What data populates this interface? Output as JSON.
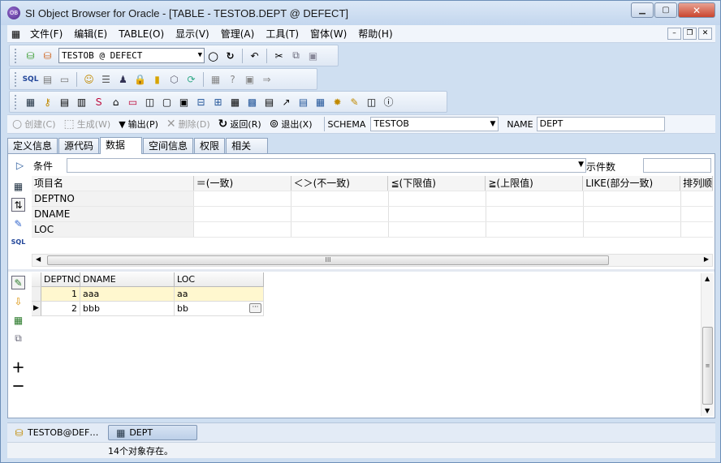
{
  "window": {
    "title": "SI Object Browser for Oracle - [TABLE - TESTOB.DEPT @ DEFECT]",
    "app_icon": "OB"
  },
  "menu": [
    "文件(F)",
    "编辑(E)",
    "TABLE(O)",
    "显示(V)",
    "管理(A)",
    "工具(T)",
    "窗体(W)",
    "帮助(H)"
  ],
  "toolbar": {
    "connection": "TESTOB @ DEFECT"
  },
  "actions": {
    "create": "创建(C)",
    "generate": "生成(W)",
    "output": "输出(P)",
    "delete": "删除(D)",
    "back": "返回(R)",
    "exit": "退出(X)",
    "schema_label": "SCHEMA",
    "schema_value": "TESTOB",
    "name_label": "NAME",
    "name_value": "DEPT"
  },
  "tabs": [
    "定义信息",
    "源代码",
    "数据",
    "空间信息",
    "权限",
    "相关"
  ],
  "condition": {
    "label": "条件",
    "count_label": "示件数"
  },
  "cond_grid": {
    "headers": [
      "项目名",
      "＝(一致)",
      "＜＞(不一致)",
      "≦(下限值)",
      "≧(上限值)",
      "LIKE(部分一致)",
      "排列顺"
    ],
    "items": [
      "DEPTNO",
      "DNAME",
      "LOC"
    ]
  },
  "data_grid": {
    "headers": [
      "DEPTNO",
      "DNAME",
      "LOC"
    ],
    "rows": [
      [
        "1",
        "aaa",
        "aa"
      ],
      [
        "2",
        "bbb",
        "bb"
      ]
    ]
  },
  "docbar": {
    "item1": "TESTOB@DEF…",
    "item2": "DEPT"
  },
  "status": {
    "text": "14个对象存在。"
  }
}
